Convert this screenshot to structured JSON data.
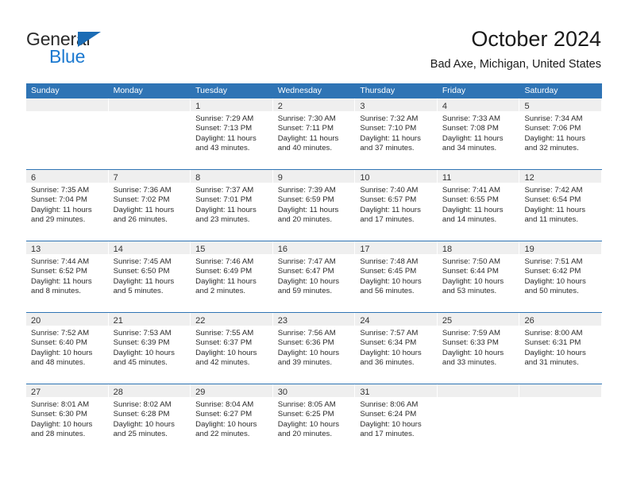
{
  "brand": {
    "name_top": "General",
    "name_bottom": "Blue",
    "triangle_color": "#1b6cb5",
    "blue_color": "#1b79d0"
  },
  "header": {
    "title": "October 2024",
    "subtitle": "Bad Axe, Michigan, United States"
  },
  "theme": {
    "header_blue": "#2f74b5",
    "day_band_gray": "#efefef",
    "row_divider": "#2f74b5"
  },
  "calendar": {
    "weekday_headers": [
      "Sunday",
      "Monday",
      "Tuesday",
      "Wednesday",
      "Thursday",
      "Friday",
      "Saturday"
    ],
    "weeks": [
      [
        {
          "day": "",
          "sunrise": "",
          "sunset": "",
          "daylight": ""
        },
        {
          "day": "",
          "sunrise": "",
          "sunset": "",
          "daylight": ""
        },
        {
          "day": "1",
          "sunrise": "Sunrise: 7:29 AM",
          "sunset": "Sunset: 7:13 PM",
          "daylight": "Daylight: 11 hours and 43 minutes."
        },
        {
          "day": "2",
          "sunrise": "Sunrise: 7:30 AM",
          "sunset": "Sunset: 7:11 PM",
          "daylight": "Daylight: 11 hours and 40 minutes."
        },
        {
          "day": "3",
          "sunrise": "Sunrise: 7:32 AM",
          "sunset": "Sunset: 7:10 PM",
          "daylight": "Daylight: 11 hours and 37 minutes."
        },
        {
          "day": "4",
          "sunrise": "Sunrise: 7:33 AM",
          "sunset": "Sunset: 7:08 PM",
          "daylight": "Daylight: 11 hours and 34 minutes."
        },
        {
          "day": "5",
          "sunrise": "Sunrise: 7:34 AM",
          "sunset": "Sunset: 7:06 PM",
          "daylight": "Daylight: 11 hours and 32 minutes."
        }
      ],
      [
        {
          "day": "6",
          "sunrise": "Sunrise: 7:35 AM",
          "sunset": "Sunset: 7:04 PM",
          "daylight": "Daylight: 11 hours and 29 minutes."
        },
        {
          "day": "7",
          "sunrise": "Sunrise: 7:36 AM",
          "sunset": "Sunset: 7:02 PM",
          "daylight": "Daylight: 11 hours and 26 minutes."
        },
        {
          "day": "8",
          "sunrise": "Sunrise: 7:37 AM",
          "sunset": "Sunset: 7:01 PM",
          "daylight": "Daylight: 11 hours and 23 minutes."
        },
        {
          "day": "9",
          "sunrise": "Sunrise: 7:39 AM",
          "sunset": "Sunset: 6:59 PM",
          "daylight": "Daylight: 11 hours and 20 minutes."
        },
        {
          "day": "10",
          "sunrise": "Sunrise: 7:40 AM",
          "sunset": "Sunset: 6:57 PM",
          "daylight": "Daylight: 11 hours and 17 minutes."
        },
        {
          "day": "11",
          "sunrise": "Sunrise: 7:41 AM",
          "sunset": "Sunset: 6:55 PM",
          "daylight": "Daylight: 11 hours and 14 minutes."
        },
        {
          "day": "12",
          "sunrise": "Sunrise: 7:42 AM",
          "sunset": "Sunset: 6:54 PM",
          "daylight": "Daylight: 11 hours and 11 minutes."
        }
      ],
      [
        {
          "day": "13",
          "sunrise": "Sunrise: 7:44 AM",
          "sunset": "Sunset: 6:52 PM",
          "daylight": "Daylight: 11 hours and 8 minutes."
        },
        {
          "day": "14",
          "sunrise": "Sunrise: 7:45 AM",
          "sunset": "Sunset: 6:50 PM",
          "daylight": "Daylight: 11 hours and 5 minutes."
        },
        {
          "day": "15",
          "sunrise": "Sunrise: 7:46 AM",
          "sunset": "Sunset: 6:49 PM",
          "daylight": "Daylight: 11 hours and 2 minutes."
        },
        {
          "day": "16",
          "sunrise": "Sunrise: 7:47 AM",
          "sunset": "Sunset: 6:47 PM",
          "daylight": "Daylight: 10 hours and 59 minutes."
        },
        {
          "day": "17",
          "sunrise": "Sunrise: 7:48 AM",
          "sunset": "Sunset: 6:45 PM",
          "daylight": "Daylight: 10 hours and 56 minutes."
        },
        {
          "day": "18",
          "sunrise": "Sunrise: 7:50 AM",
          "sunset": "Sunset: 6:44 PM",
          "daylight": "Daylight: 10 hours and 53 minutes."
        },
        {
          "day": "19",
          "sunrise": "Sunrise: 7:51 AM",
          "sunset": "Sunset: 6:42 PM",
          "daylight": "Daylight: 10 hours and 50 minutes."
        }
      ],
      [
        {
          "day": "20",
          "sunrise": "Sunrise: 7:52 AM",
          "sunset": "Sunset: 6:40 PM",
          "daylight": "Daylight: 10 hours and 48 minutes."
        },
        {
          "day": "21",
          "sunrise": "Sunrise: 7:53 AM",
          "sunset": "Sunset: 6:39 PM",
          "daylight": "Daylight: 10 hours and 45 minutes."
        },
        {
          "day": "22",
          "sunrise": "Sunrise: 7:55 AM",
          "sunset": "Sunset: 6:37 PM",
          "daylight": "Daylight: 10 hours and 42 minutes."
        },
        {
          "day": "23",
          "sunrise": "Sunrise: 7:56 AM",
          "sunset": "Sunset: 6:36 PM",
          "daylight": "Daylight: 10 hours and 39 minutes."
        },
        {
          "day": "24",
          "sunrise": "Sunrise: 7:57 AM",
          "sunset": "Sunset: 6:34 PM",
          "daylight": "Daylight: 10 hours and 36 minutes."
        },
        {
          "day": "25",
          "sunrise": "Sunrise: 7:59 AM",
          "sunset": "Sunset: 6:33 PM",
          "daylight": "Daylight: 10 hours and 33 minutes."
        },
        {
          "day": "26",
          "sunrise": "Sunrise: 8:00 AM",
          "sunset": "Sunset: 6:31 PM",
          "daylight": "Daylight: 10 hours and 31 minutes."
        }
      ],
      [
        {
          "day": "27",
          "sunrise": "Sunrise: 8:01 AM",
          "sunset": "Sunset: 6:30 PM",
          "daylight": "Daylight: 10 hours and 28 minutes."
        },
        {
          "day": "28",
          "sunrise": "Sunrise: 8:02 AM",
          "sunset": "Sunset: 6:28 PM",
          "daylight": "Daylight: 10 hours and 25 minutes."
        },
        {
          "day": "29",
          "sunrise": "Sunrise: 8:04 AM",
          "sunset": "Sunset: 6:27 PM",
          "daylight": "Daylight: 10 hours and 22 minutes."
        },
        {
          "day": "30",
          "sunrise": "Sunrise: 8:05 AM",
          "sunset": "Sunset: 6:25 PM",
          "daylight": "Daylight: 10 hours and 20 minutes."
        },
        {
          "day": "31",
          "sunrise": "Sunrise: 8:06 AM",
          "sunset": "Sunset: 6:24 PM",
          "daylight": "Daylight: 10 hours and 17 minutes."
        },
        {
          "day": "",
          "sunrise": "",
          "sunset": "",
          "daylight": ""
        },
        {
          "day": "",
          "sunrise": "",
          "sunset": "",
          "daylight": ""
        }
      ]
    ]
  }
}
